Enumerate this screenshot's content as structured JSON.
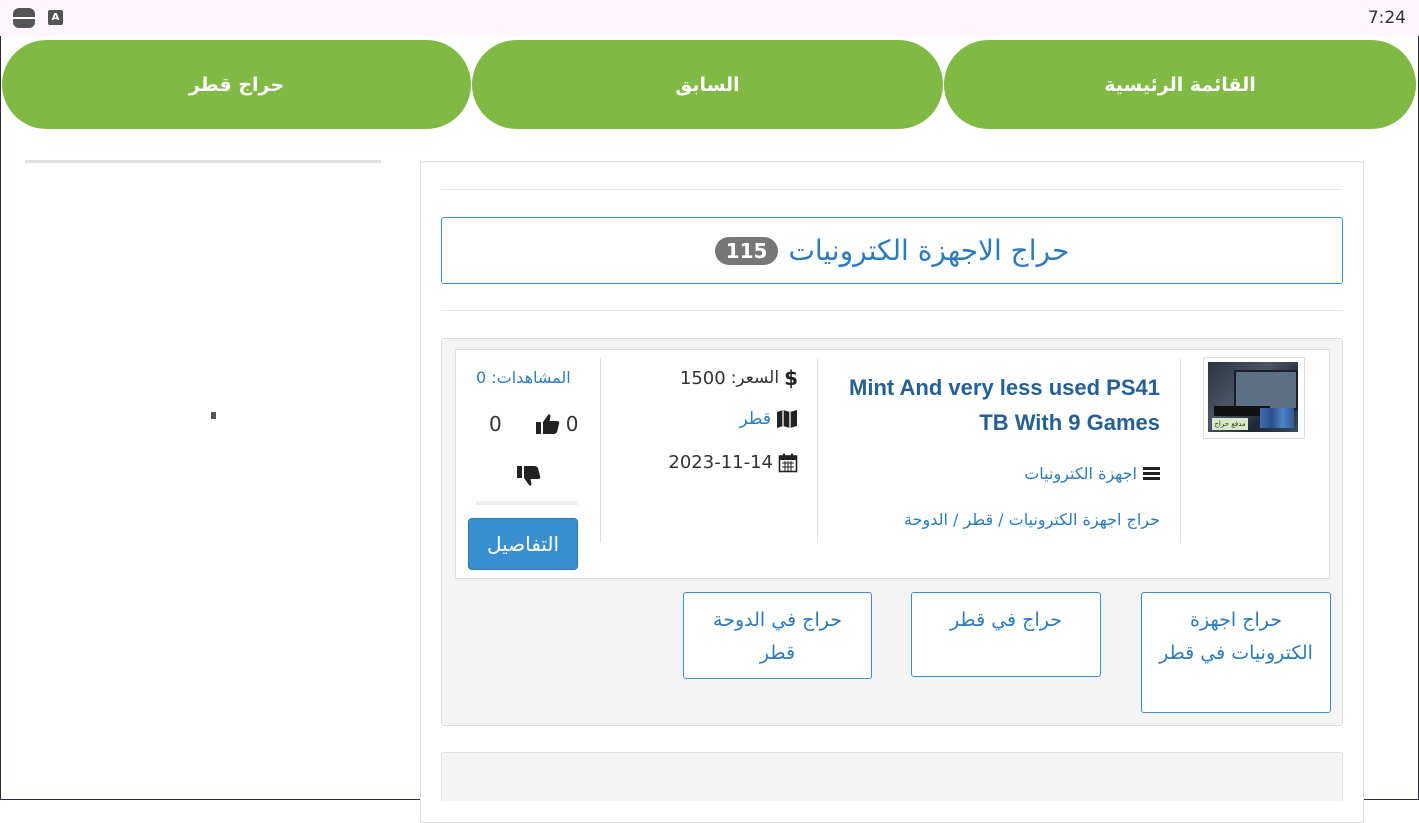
{
  "status_bar": {
    "time": "7:24",
    "icon1": "minus-circle-icon",
    "icon2": "a-badge-icon",
    "icon2_glyph": "A"
  },
  "nav": {
    "home_label": "القائمة الرئيسية",
    "prev_label": "السابق",
    "qatar_label": "حراج قطر",
    "color": "#80b944"
  },
  "category": {
    "title": "حراج الاجهزة الكترونيات",
    "count": "115"
  },
  "listing": {
    "title": "Mint And very less used PS41 TB With 9 Games",
    "category": "اجهزة الكترونيات",
    "breadcrumb": "حراج اجهزة الكترونيات / قطر / الدوحة",
    "price_label": "السعر:",
    "price_value": "1500",
    "location": "قطر",
    "date": "2023-11-14",
    "views_label": "المشاهدات:",
    "views_value": "0",
    "likes": "0",
    "dislikes": "0",
    "details_label": "التفاصيل",
    "thumb_tag": "مدفع حراج"
  },
  "tags": [
    "حراج اجهزة الكترونيات في قطر",
    "حراج في قطر",
    "حراج في الدوحة قطر"
  ],
  "colors": {
    "accent_blue": "#2a7bc0",
    "button_blue": "#3a8fd0",
    "count_badge": "#777777"
  }
}
